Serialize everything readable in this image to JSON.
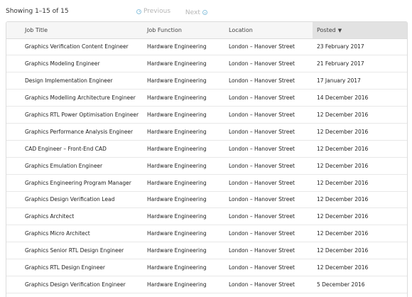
{
  "topbar": {
    "showing": "Showing 1–15 of 15",
    "prev_label": "Previous",
    "next_label": "Next"
  },
  "columns": {
    "title": "Job Title",
    "function": "Job Function",
    "location": "Location",
    "posted": "Posted",
    "sort_indicator": "▼"
  },
  "rows": [
    {
      "title": "Graphics Verification Content Engineer",
      "function": "Hardware Engineering",
      "location": "London – Hanover Street",
      "posted": "23 February 2017"
    },
    {
      "title": "Graphics Modeling Engineer",
      "function": "Hardware Engineering",
      "location": "London – Hanover Street",
      "posted": "21 February 2017"
    },
    {
      "title": "Design Implementation Engineer",
      "function": "Hardware Engineering",
      "location": "London – Hanover Street",
      "posted": "17 January 2017"
    },
    {
      "title": "Graphics Modelling Architecture Engineer",
      "function": "Hardware Engineering",
      "location": "London – Hanover Street",
      "posted": "14 December 2016"
    },
    {
      "title": "Graphics RTL Power Optimisation Engineer",
      "function": "Hardware Engineering",
      "location": "London – Hanover Street",
      "posted": "12 December 2016"
    },
    {
      "title": "Graphics Performance Analysis Engineer",
      "function": "Hardware Engineering",
      "location": "London – Hanover Street",
      "posted": "12 December 2016"
    },
    {
      "title": "CAD Engineer – Front-End CAD",
      "function": "Hardware Engineering",
      "location": "London – Hanover Street",
      "posted": "12 December 2016"
    },
    {
      "title": "Graphics Emulation Engineer",
      "function": "Hardware Engineering",
      "location": "London – Hanover Street",
      "posted": "12 December 2016"
    },
    {
      "title": "Graphics Engineering Program Manager",
      "function": "Hardware Engineering",
      "location": "London – Hanover Street",
      "posted": "12 December 2016"
    },
    {
      "title": "Graphics Design Verification Lead",
      "function": "Hardware Engineering",
      "location": "London – Hanover Street",
      "posted": "12 December 2016"
    },
    {
      "title": "Graphics Architect",
      "function": "Hardware Engineering",
      "location": "London – Hanover Street",
      "posted": "12 December 2016"
    },
    {
      "title": "Graphics Micro Architect",
      "function": "Hardware Engineering",
      "location": "London – Hanover Street",
      "posted": "12 December 2016"
    },
    {
      "title": "Graphics Senior RTL Design Engineer",
      "function": "Hardware Engineering",
      "location": "London – Hanover Street",
      "posted": "12 December 2016"
    },
    {
      "title": "Graphics RTL Design Engineer",
      "function": "Hardware Engineering",
      "location": "London – Hanover Street",
      "posted": "12 December 2016"
    },
    {
      "title": "Graphics Design Verification Engineer",
      "function": "Hardware Engineering",
      "location": "London – Hanover Street",
      "posted": "5 December 2016"
    }
  ]
}
